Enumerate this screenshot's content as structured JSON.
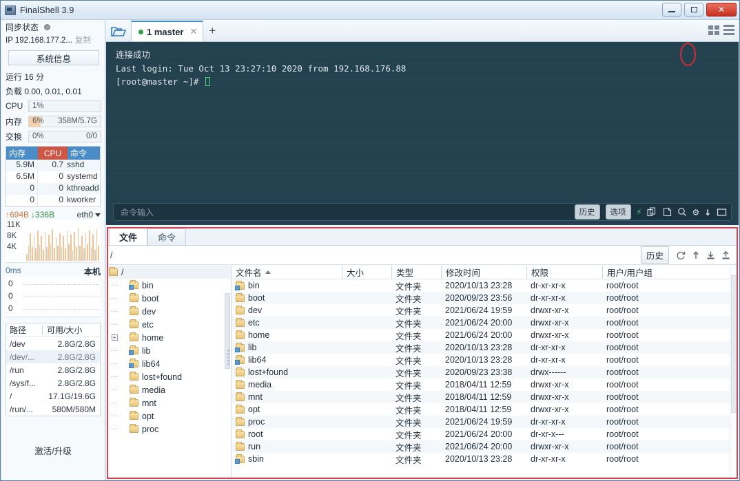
{
  "window": {
    "title": "FinalShell 3.9",
    "icon": "app-icon",
    "minimize_label": "–",
    "maximize_label": "□",
    "close_label": "✕"
  },
  "sidebar": {
    "sync_label": "同步状态",
    "ip_label": "IP 192.168.177.2...",
    "copy_label": "复制",
    "sysinfo_button": "系统信息",
    "uptime": "运行 16 分",
    "load": "负载 0.00, 0.01, 0.01",
    "meters": [
      {
        "name": "CPU",
        "pct": "1%",
        "value": "",
        "fill_color": "#d9ead3",
        "fill_width": "1%"
      },
      {
        "name": "内存",
        "pct": "6%",
        "value": "358M/5.7G",
        "fill_color": "#f6d0ad",
        "fill_width": "16%"
      },
      {
        "name": "交换",
        "pct": "0%",
        "value": "0/0",
        "fill_color": "#eef2f6",
        "fill_width": "0%"
      }
    ],
    "process_table": {
      "headers": [
        "内存",
        "CPU",
        "命令"
      ],
      "header_colors": {
        "mem": "#4a8cc7",
        "cpu": "#cf5544",
        "cmd": "#4a8cc7"
      },
      "rows": [
        {
          "mem": "5.9M",
          "cpu": "0.7",
          "cmd": "sshd"
        },
        {
          "mem": "6.5M",
          "cpu": "0",
          "cmd": "systemd"
        },
        {
          "mem": "0",
          "cpu": "0",
          "cmd": "kthreadd"
        },
        {
          "mem": "0",
          "cpu": "0",
          "cmd": "kworker"
        }
      ]
    },
    "network": {
      "up": "↑694B",
      "down": "↓336B",
      "interface": "eth0",
      "axis": [
        "11K",
        "8K",
        "4K"
      ],
      "bars": [
        9,
        22,
        40,
        20,
        38,
        18,
        44,
        22,
        36,
        16,
        42,
        20,
        38,
        24,
        46,
        18,
        34,
        22,
        40,
        20,
        36,
        18,
        44,
        24,
        38,
        16,
        42,
        20,
        48,
        22,
        36,
        18,
        40,
        24,
        44,
        20,
        38,
        16,
        46,
        22
      ]
    },
    "latency": {
      "unit": "0ms",
      "local_label": "本机",
      "axis": [
        "0",
        "0",
        "0"
      ]
    },
    "disk_table": {
      "headers": [
        "路径",
        "可用/大小"
      ],
      "rows": [
        {
          "path": "/dev",
          "size": "2.8G/2.8G",
          "alt": false
        },
        {
          "path": "/dev/...",
          "size": "2.8G/2.8G",
          "alt": true
        },
        {
          "path": "/run",
          "size": "2.8G/2.8G",
          "alt": false
        },
        {
          "path": "/sys/f...",
          "size": "2.8G/2.8G",
          "alt": false
        },
        {
          "path": "/",
          "size": "17.1G/19.6G",
          "alt": false
        },
        {
          "path": "/run/...",
          "size": "580M/580M",
          "alt": false
        }
      ]
    },
    "activate_label": "激活/升级"
  },
  "tabbar": {
    "folder_icon": "open-folder-icon",
    "tab_label": "1 master",
    "tab_status_color": "#2aa23d",
    "tab_close": "✕",
    "new_tab": "+",
    "view_grid_icon": "grid-view-icon",
    "view_list_icon": "list-view-icon"
  },
  "terminal": {
    "lines": [
      {
        "text": "连接成功",
        "cn": true
      },
      {
        "text": "Last login: Tue Oct 13 23:27:10 2020 from 192.168.176.88",
        "cn": false
      },
      {
        "text": "[root@master ~]# ",
        "cn": false,
        "cursor": true
      }
    ],
    "background": "#23404f",
    "command_input": {
      "placeholder": "命令输入",
      "value": ""
    },
    "buttons": {
      "history": "历史",
      "options": "选项"
    },
    "icons": [
      {
        "name": "bolt-icon",
        "glyph": "⚡"
      },
      {
        "name": "copy-icon",
        "glyph": "❐"
      },
      {
        "name": "paste-icon",
        "glyph": "❐"
      },
      {
        "name": "search-icon",
        "glyph": "⚲"
      },
      {
        "name": "gear-icon",
        "glyph": "⚙"
      },
      {
        "name": "scroll-down-icon",
        "glyph": "↓"
      },
      {
        "name": "fullscreen-icon",
        "glyph": "▭"
      }
    ],
    "annotation": "red-ellipse-around-scroll-down-icon"
  },
  "file_manager": {
    "tabs": [
      {
        "label": "文件",
        "active": true
      },
      {
        "label": "命令",
        "active": false
      }
    ],
    "path": "/",
    "path_placeholder": "/",
    "toolbar": {
      "history": "历史",
      "icons": [
        {
          "name": "refresh-icon",
          "glyph": "↻"
        },
        {
          "name": "upload-arrow-icon",
          "glyph": "↑"
        },
        {
          "name": "download-icon",
          "glyph": "⤓"
        },
        {
          "name": "upload-icon",
          "glyph": "⤒"
        }
      ]
    },
    "tree": [
      {
        "label": "/",
        "depth": 0,
        "root": true,
        "expander": false,
        "link": false
      },
      {
        "label": "bin",
        "depth": 1,
        "root": false,
        "expander": false,
        "link": true
      },
      {
        "label": "boot",
        "depth": 1,
        "root": false,
        "expander": false,
        "link": false
      },
      {
        "label": "dev",
        "depth": 1,
        "root": false,
        "expander": false,
        "link": false
      },
      {
        "label": "etc",
        "depth": 1,
        "root": false,
        "expander": false,
        "link": false
      },
      {
        "label": "home",
        "depth": 1,
        "root": false,
        "expander": true,
        "link": false
      },
      {
        "label": "lib",
        "depth": 1,
        "root": false,
        "expander": false,
        "link": true
      },
      {
        "label": "lib64",
        "depth": 1,
        "root": false,
        "expander": false,
        "link": true
      },
      {
        "label": "lost+found",
        "depth": 1,
        "root": false,
        "expander": false,
        "link": false
      },
      {
        "label": "media",
        "depth": 1,
        "root": false,
        "expander": false,
        "link": false
      },
      {
        "label": "mnt",
        "depth": 1,
        "root": false,
        "expander": false,
        "link": false
      },
      {
        "label": "opt",
        "depth": 1,
        "root": false,
        "expander": false,
        "link": false
      },
      {
        "label": "proc",
        "depth": 1,
        "root": false,
        "expander": false,
        "link": false
      }
    ],
    "columns": [
      "文件名",
      "大小",
      "类型",
      "修改时间",
      "权限",
      "用户/用户组"
    ],
    "sort_column": "文件名",
    "sort_direction": "asc",
    "files": [
      {
        "name": "bin",
        "size": "",
        "type": "文件夹",
        "time": "2020/10/13 23:28",
        "perm": "dr-xr-xr-x",
        "owner": "root/root",
        "link": true
      },
      {
        "name": "boot",
        "size": "",
        "type": "文件夹",
        "time": "2020/09/23 23:56",
        "perm": "dr-xr-xr-x",
        "owner": "root/root",
        "link": false
      },
      {
        "name": "dev",
        "size": "",
        "type": "文件夹",
        "time": "2021/06/24 19:59",
        "perm": "drwxr-xr-x",
        "owner": "root/root",
        "link": false
      },
      {
        "name": "etc",
        "size": "",
        "type": "文件夹",
        "time": "2021/06/24 20:00",
        "perm": "drwxr-xr-x",
        "owner": "root/root",
        "link": false
      },
      {
        "name": "home",
        "size": "",
        "type": "文件夹",
        "time": "2021/06/24 20:00",
        "perm": "drwxr-xr-x",
        "owner": "root/root",
        "link": false
      },
      {
        "name": "lib",
        "size": "",
        "type": "文件夹",
        "time": "2020/10/13 23:28",
        "perm": "dr-xr-xr-x",
        "owner": "root/root",
        "link": true
      },
      {
        "name": "lib64",
        "size": "",
        "type": "文件夹",
        "time": "2020/10/13 23:28",
        "perm": "dr-xr-xr-x",
        "owner": "root/root",
        "link": true
      },
      {
        "name": "lost+found",
        "size": "",
        "type": "文件夹",
        "time": "2020/09/23 23:38",
        "perm": "drwx------",
        "owner": "root/root",
        "link": false
      },
      {
        "name": "media",
        "size": "",
        "type": "文件夹",
        "time": "2018/04/11 12:59",
        "perm": "drwxr-xr-x",
        "owner": "root/root",
        "link": false
      },
      {
        "name": "mnt",
        "size": "",
        "type": "文件夹",
        "time": "2018/04/11 12:59",
        "perm": "drwxr-xr-x",
        "owner": "root/root",
        "link": false
      },
      {
        "name": "opt",
        "size": "",
        "type": "文件夹",
        "time": "2018/04/11 12:59",
        "perm": "drwxr-xr-x",
        "owner": "root/root",
        "link": false
      },
      {
        "name": "proc",
        "size": "",
        "type": "文件夹",
        "time": "2021/06/24 19:59",
        "perm": "dr-xr-xr-x",
        "owner": "root/root",
        "link": false
      },
      {
        "name": "root",
        "size": "",
        "type": "文件夹",
        "time": "2021/06/24 20:00",
        "perm": "dr-xr-x---",
        "owner": "root/root",
        "link": false
      },
      {
        "name": "run",
        "size": "",
        "type": "文件夹",
        "time": "2021/06/24 20:00",
        "perm": "drwxr-xr-x",
        "owner": "root/root",
        "link": false
      },
      {
        "name": "sbin",
        "size": "",
        "type": "文件夹",
        "time": "2020/10/13 23:28",
        "perm": "dr-xr-xr-x",
        "owner": "root/root",
        "link": true
      }
    ]
  },
  "colors": {
    "accent": "#3f8fd0",
    "terminal_bg": "#23404f",
    "annotation_red": "#d8434f",
    "cpu_header": "#cf5544",
    "mem_header": "#4a8cc7"
  }
}
